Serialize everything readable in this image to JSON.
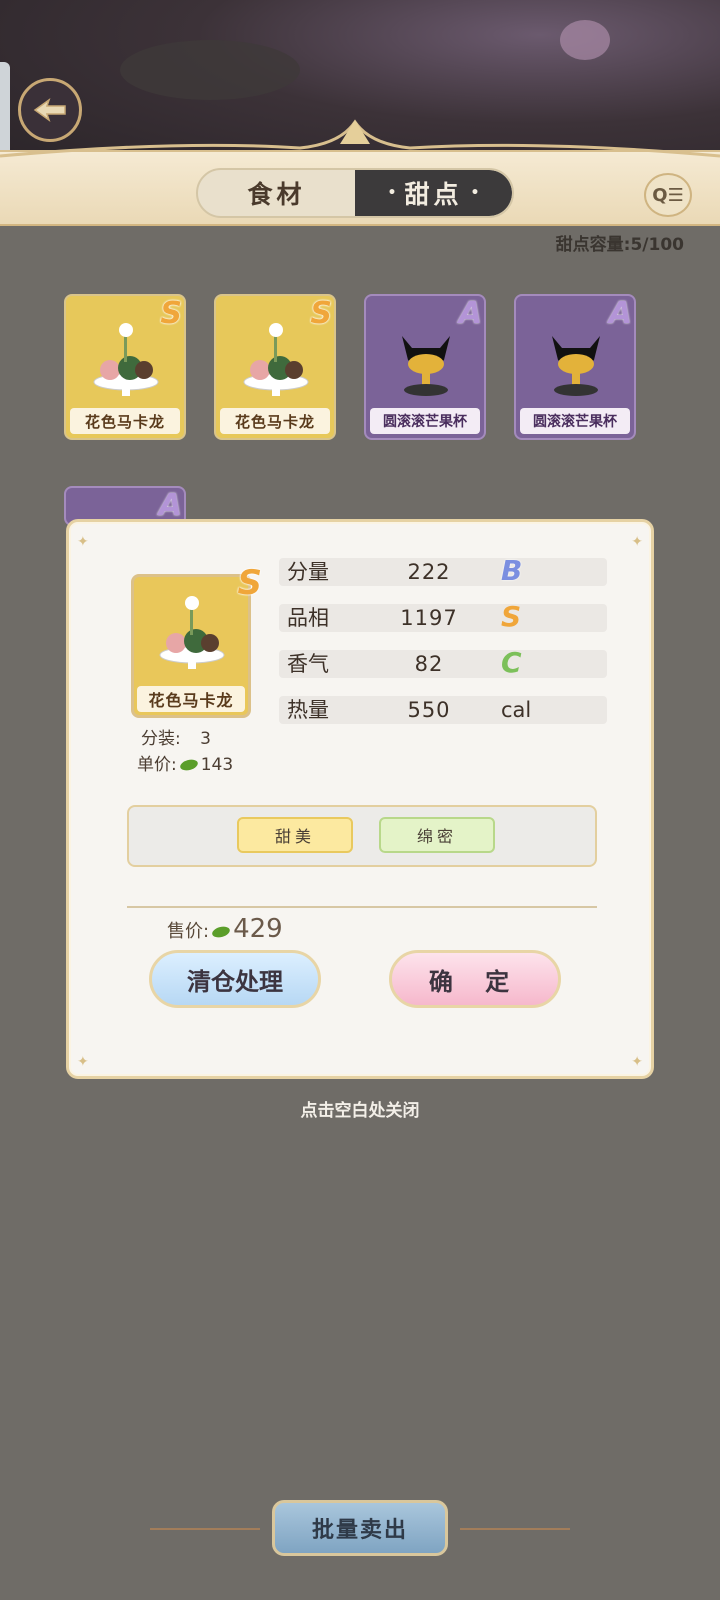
{
  "header": {
    "tabs": [
      "食材",
      "甜点"
    ],
    "active_tab": "甜点",
    "capacity_label": "甜点容量:",
    "capacity_value": "5/100"
  },
  "grid": [
    {
      "name": "花色马卡龙",
      "grade": "S"
    },
    {
      "name": "花色马卡龙",
      "grade": "S"
    },
    {
      "name": "圆滚滚芒果杯",
      "grade": "A"
    },
    {
      "name": "圆滚滚芒果杯",
      "grade": "A"
    },
    {
      "name": "",
      "grade": "A"
    }
  ],
  "detail": {
    "name": "花色马卡龙",
    "grade": "S",
    "pack_label": "分装:",
    "pack_value": "3",
    "unit_price_label": "单价:",
    "unit_price_value": "143",
    "stats": [
      {
        "label": "分量",
        "value": "222",
        "grade": "B"
      },
      {
        "label": "品相",
        "value": "1197",
        "grade": "S"
      },
      {
        "label": "香气",
        "value": "82",
        "grade": "C"
      },
      {
        "label": "热量",
        "value": "550",
        "unit": "cal"
      }
    ],
    "tags": [
      "甜美",
      "绵密"
    ],
    "sell_price_label": "售价:",
    "sell_price_value": "429",
    "clear_button": "清仓处理",
    "confirm_button": "确 定"
  },
  "close_hint": "点击空白处关闭",
  "batch_sell_button": "批量卖出",
  "colors": {
    "header_bg": "#f5ead3",
    "active_tab_bg": "#3c3a3b",
    "s_grade": "#f0a63a",
    "a_grade": "#b394d7",
    "b_grade": "#7b8fe0",
    "c_grade": "#7cc05a"
  }
}
